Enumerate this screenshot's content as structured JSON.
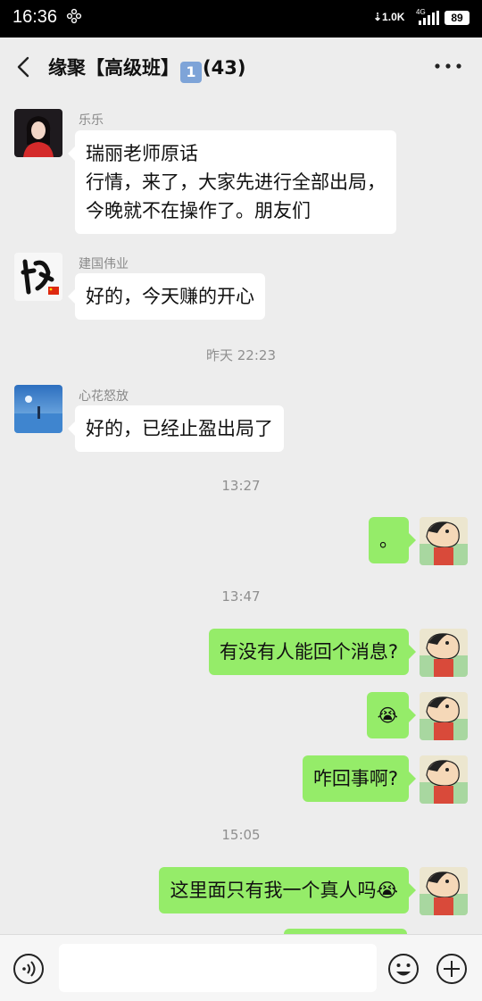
{
  "status_bar": {
    "time": "16:36",
    "network_speed": "⇣1.0K",
    "network_type": "4G",
    "battery": "89"
  },
  "header": {
    "title_prefix": "缘聚【高级班】",
    "badge": "1",
    "member_count": "(43)"
  },
  "messages": [
    {
      "direction": "incoming",
      "sender": "乐乐",
      "lines": [
        "瑞丽老师原话",
        "行情，来了，大家先进行全部出局，",
        "今晚就不在操作了。朋友们"
      ]
    },
    {
      "direction": "incoming",
      "sender": "建国伟业",
      "lines": [
        "好的，今天赚的开心"
      ]
    },
    {
      "type": "timestamp",
      "text": "昨天 22:23"
    },
    {
      "direction": "incoming",
      "sender": "心花怒放",
      "lines": [
        "好的，已经止盈出局了"
      ]
    },
    {
      "type": "timestamp",
      "text": "13:27"
    },
    {
      "direction": "outgoing",
      "lines": [
        "。"
      ]
    },
    {
      "type": "timestamp",
      "text": "13:47"
    },
    {
      "direction": "outgoing",
      "lines": [
        "有没有人能回个消息?"
      ]
    },
    {
      "direction": "outgoing",
      "lines": [
        "😭"
      ]
    },
    {
      "direction": "outgoing",
      "lines": [
        "咋回事啊?"
      ]
    },
    {
      "type": "timestamp",
      "text": "15:05"
    },
    {
      "direction": "outgoing",
      "lines": [
        "这里面只有我一个真人吗😭"
      ]
    }
  ],
  "colors": {
    "background": "#ededed",
    "outgoing_bubble": "#95ec69",
    "incoming_bubble": "#ffffff",
    "timestamp_text": "#8f8f8f"
  },
  "icons": {
    "back": "chevron-left-icon",
    "more": "more-dots-icon",
    "voice": "voice-icon",
    "emoji": "smiley-icon",
    "plus": "plus-icon"
  }
}
